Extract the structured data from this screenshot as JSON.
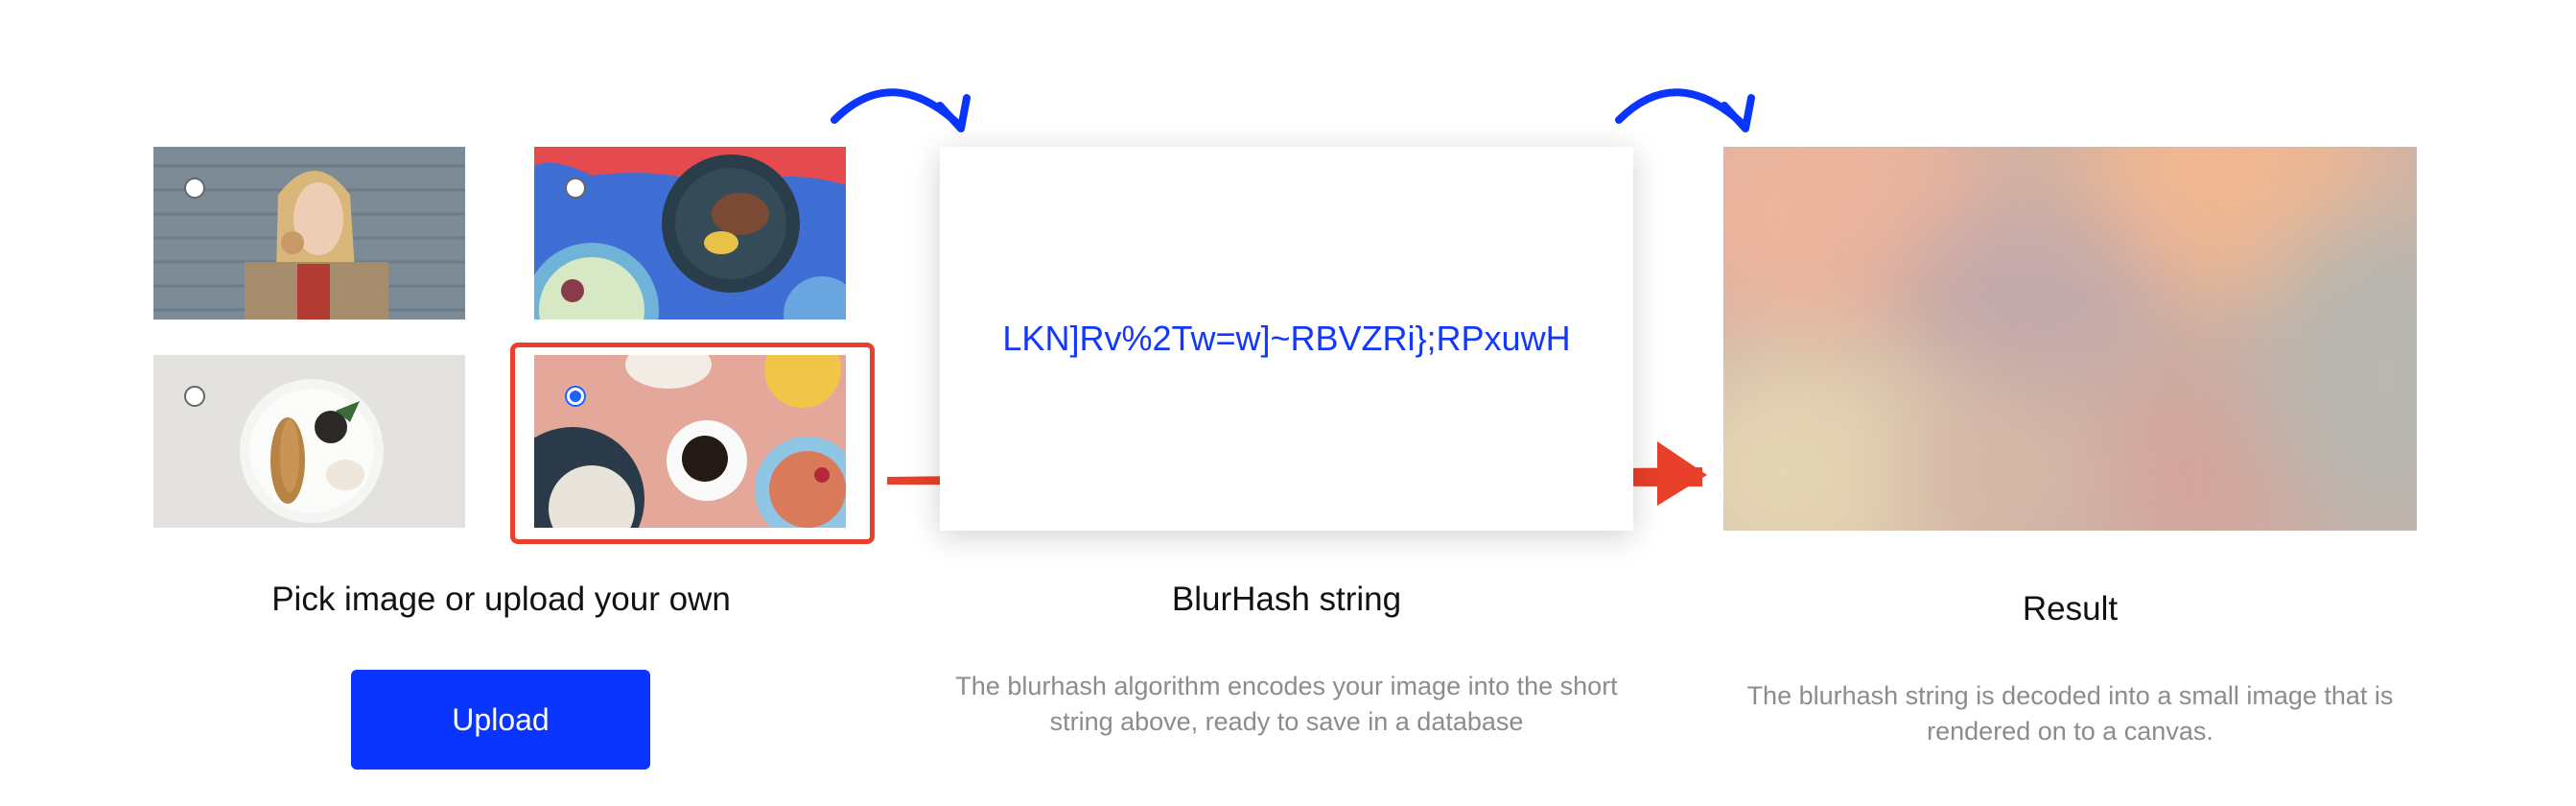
{
  "picker": {
    "caption": "Pick image or upload your own",
    "upload_label": "Upload",
    "thumbnails": [
      {
        "subject": "woman eating",
        "selected": false
      },
      {
        "subject": "food on blue",
        "selected": false
      },
      {
        "subject": "plate with bread",
        "selected": false
      },
      {
        "subject": "coffee on pink table",
        "selected": true
      }
    ]
  },
  "blurhash": {
    "value": "LKN]Rv%2Tw=w]~RBVZRi};RPxuwH",
    "caption": "BlurHash string",
    "description_line1": "The blurhash algorithm encodes your image into the short",
    "description_line2": "string above, ready to save in a database"
  },
  "result": {
    "caption": "Result",
    "description_line1": "The blurhash string is decoded into a small image that is",
    "description_line2": "rendered on to a canvas."
  },
  "colors": {
    "accent_blue": "#0a35ff",
    "arrow_red": "#e8402a",
    "arrow_blue": "#0a35ff"
  }
}
